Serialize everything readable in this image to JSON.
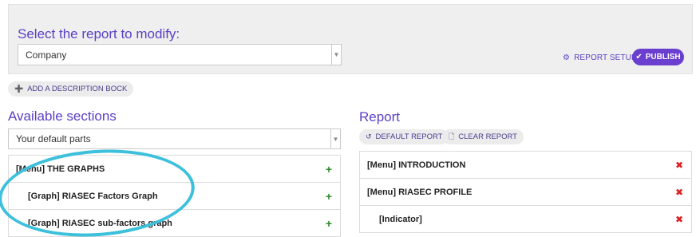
{
  "header": {
    "title": "Select the report to modify:",
    "report_select": {
      "value": "Company"
    },
    "report_setup_label": "REPORT SETUP",
    "publish_label": "PUBLISH"
  },
  "add_description_label": "ADD A DESCRIPTION BOCK",
  "available": {
    "title": "Available sections",
    "parts_select": {
      "value": "Your default parts"
    },
    "items": [
      {
        "label": "[Menu] THE GRAPHS"
      },
      {
        "label": "[Graph] RIASEC Factors Graph"
      },
      {
        "label": "[Graph] RIASEC sub-factors graph"
      }
    ]
  },
  "report": {
    "title": "Report",
    "default_report_label": "DEFAULT REPORT",
    "clear_report_label": "CLEAR REPORT",
    "items": [
      {
        "label": "[Menu] INTRODUCTION"
      },
      {
        "label": "[Menu] RIASEC PROFILE"
      },
      {
        "label": "[Indicator]"
      }
    ]
  },
  "colors": {
    "accent": "#5b3fc4",
    "publish_bg": "#6a3fd0",
    "add": "#2e8b2e",
    "remove": "#e02020",
    "highlight": "#3cc0dc"
  },
  "icons": [
    "gear-icon",
    "check-icon",
    "plus-circle-icon",
    "refresh-icon",
    "document-icon",
    "plus-icon",
    "remove-icon",
    "chevron-down-icon"
  ]
}
